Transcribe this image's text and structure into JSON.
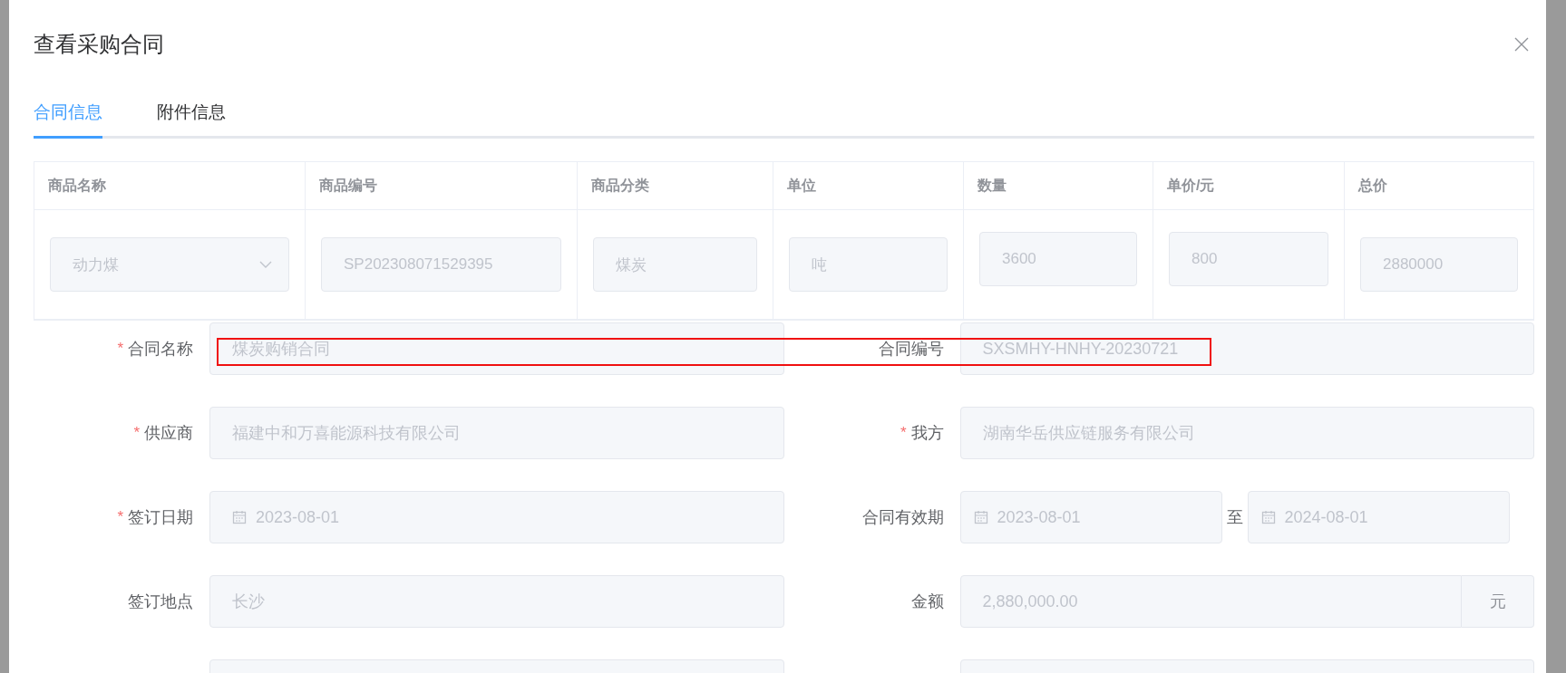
{
  "dialog": {
    "title": "查看采购合同"
  },
  "tabs": [
    {
      "label": "合同信息",
      "selected": true
    },
    {
      "label": "附件信息",
      "selected": false
    }
  ],
  "table": {
    "columns": [
      "商品名称",
      "商品编号",
      "商品分类",
      "单位",
      "数量",
      "单价/元",
      "总价"
    ],
    "rows": [
      {
        "cells": [
          {
            "kind": "select",
            "value": "动力煤",
            "disabled": true
          },
          {
            "kind": "input",
            "value": "SP202308071529395",
            "disabled": true
          },
          {
            "kind": "input",
            "value": "煤炭",
            "disabled": true
          },
          {
            "kind": "input",
            "value": "吨",
            "disabled": true
          },
          {
            "kind": "number",
            "value": "3600",
            "disabled": true
          },
          {
            "kind": "number",
            "value": "800",
            "disabled": true
          },
          {
            "kind": "input",
            "value": "2880000",
            "disabled": true
          }
        ]
      }
    ]
  },
  "form": {
    "required_mark": "*",
    "rows": [
      {
        "items": [
          {
            "kind": "text",
            "label": "合同名称",
            "required": true,
            "value": "煤炭购销合同",
            "disabled": true
          },
          {
            "kind": "text",
            "label": "合同编号",
            "required": false,
            "value": "SXSMHY-HNHY-20230721",
            "disabled": true
          }
        ]
      },
      {
        "items": [
          {
            "kind": "text",
            "label": "供应商",
            "required": true,
            "value": "福建中和万喜能源科技有限公司",
            "disabled": true
          },
          {
            "kind": "text",
            "label": "我方",
            "required": true,
            "value": "湖南华岳供应链服务有限公司",
            "disabled": true
          }
        ]
      },
      {
        "items": [
          {
            "kind": "date",
            "label": "签订日期",
            "required": true,
            "value": "2023-08-01",
            "disabled": true
          },
          {
            "kind": "daterange",
            "label": "合同有效期",
            "required": false,
            "value": "2023-08-01",
            "separator": "至",
            "value_end": "2024-08-01",
            "disabled": true
          }
        ]
      },
      {
        "items": [
          {
            "kind": "text",
            "label": "签订地点",
            "required": false,
            "value": "长沙",
            "disabled": true
          },
          {
            "kind": "amount",
            "label": "金额",
            "required": false,
            "value": "2,880,000.00",
            "suffix": "元",
            "disabled": true
          }
        ]
      }
    ]
  }
}
